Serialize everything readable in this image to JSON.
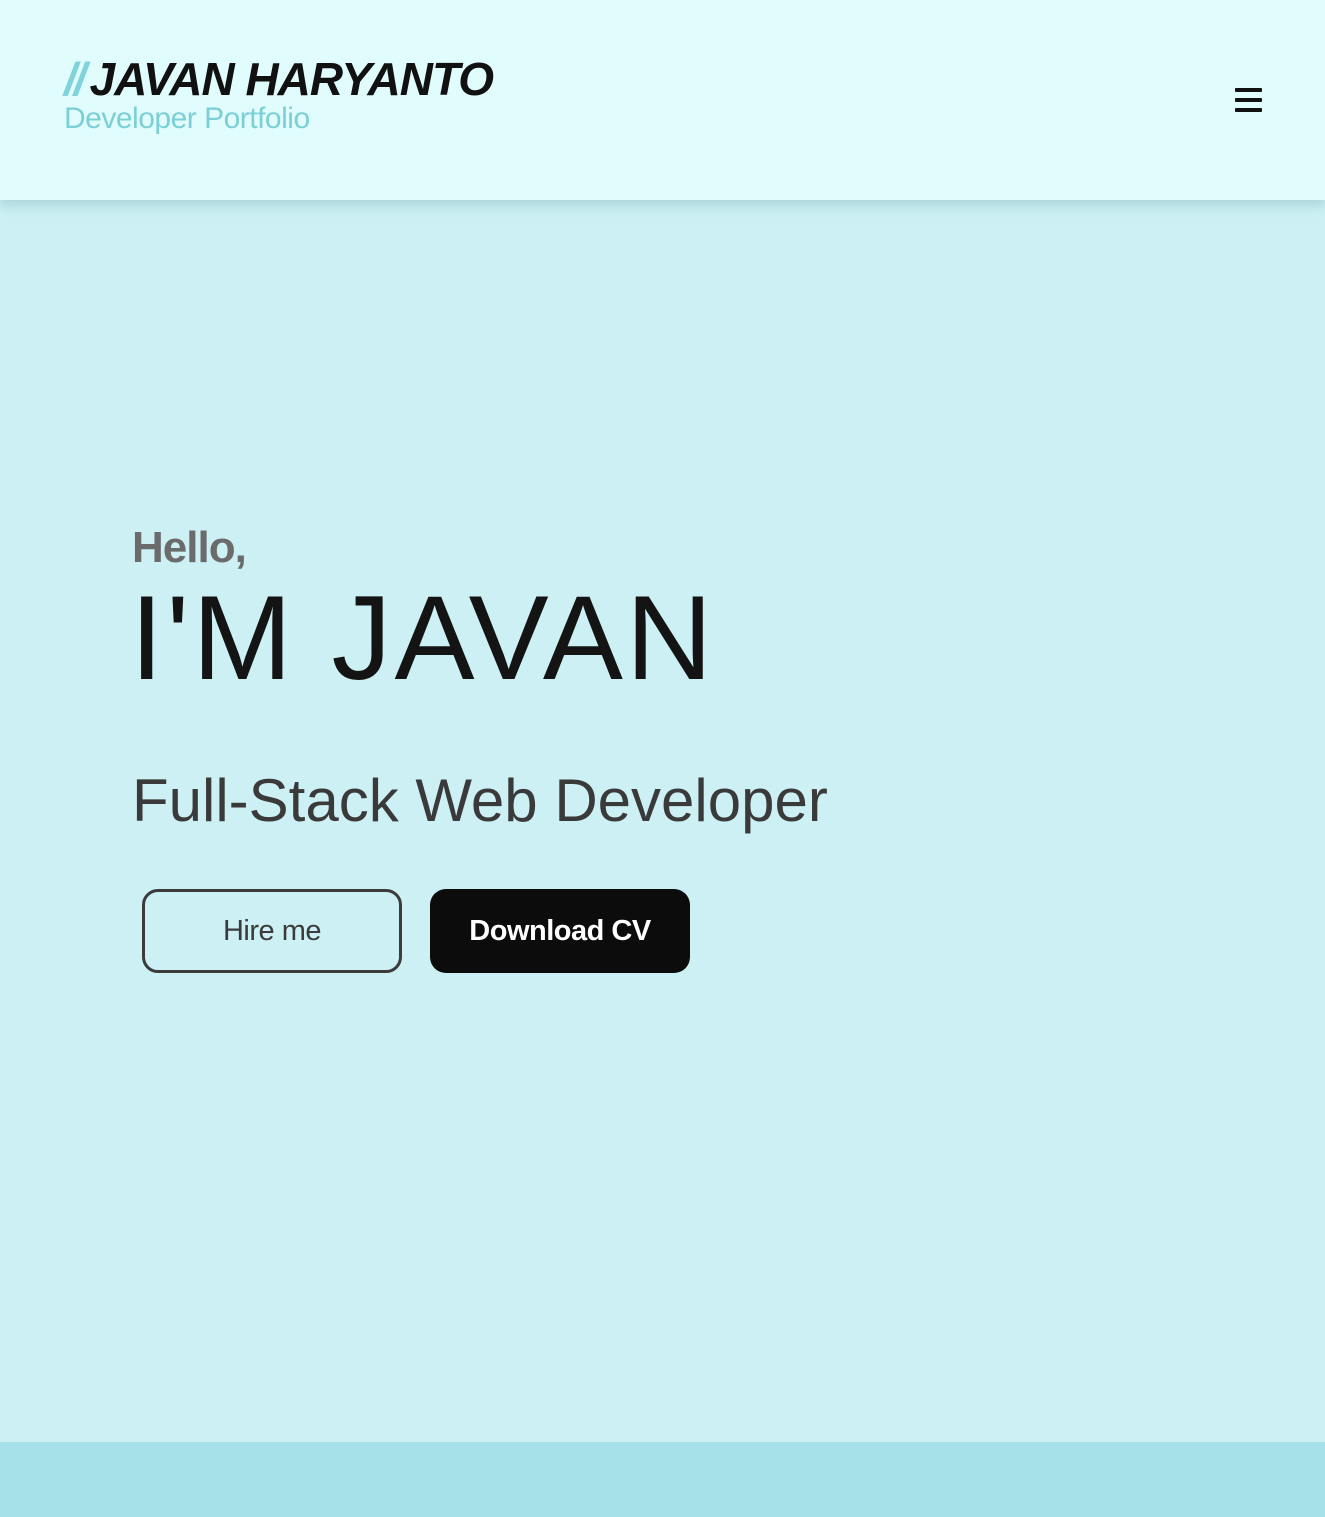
{
  "header": {
    "brand_slashes": "//",
    "brand_name": "JAVAN HARYANTO",
    "brand_subtitle": "Developer Portfolio",
    "menu_icon": "hamburger-menu-icon"
  },
  "hero": {
    "greeting": "Hello,",
    "title": "I'M JAVAN",
    "role": "Full-Stack Web Developer",
    "hire_button_label": "Hire me",
    "cv_button_label": "Download CV"
  },
  "colors": {
    "header_background": "#e0fcfc",
    "page_background": "#ccf0f3",
    "accent": "#7fd3db",
    "footer_strip": "#a6e0e8",
    "primary_button": "#0c0c0c"
  }
}
